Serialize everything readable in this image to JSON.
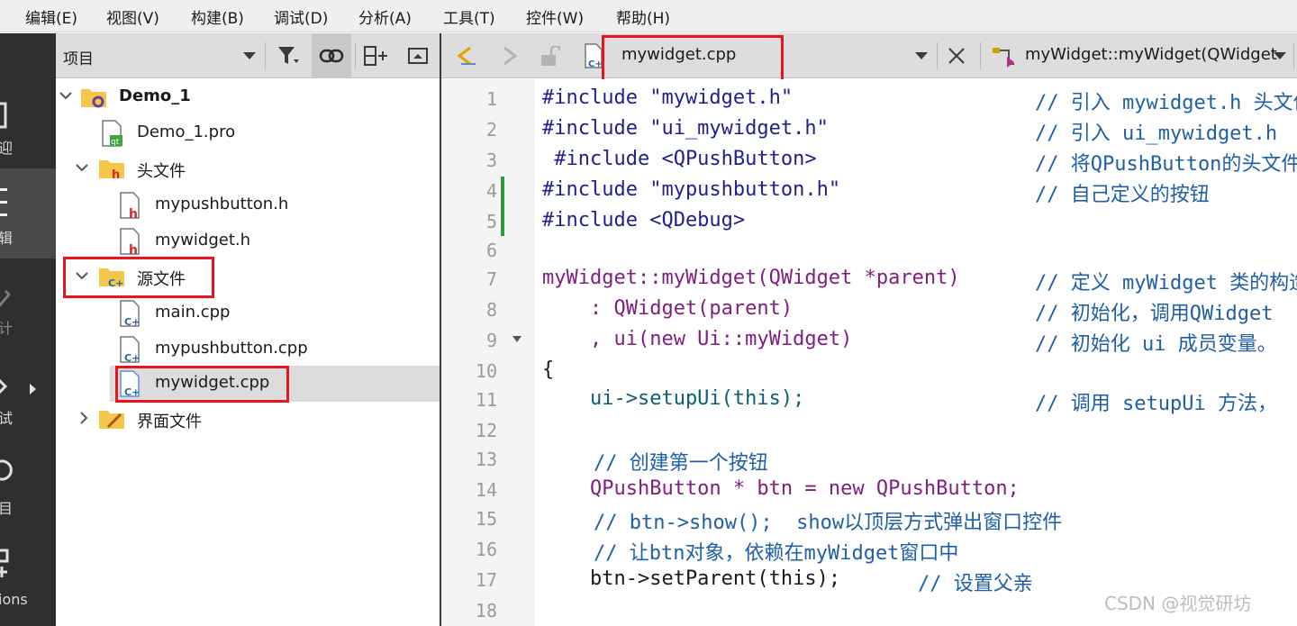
{
  "menu": [
    "编辑(E)",
    "视图(V)",
    "构建(B)",
    "调试(D)",
    "分析(A)",
    "工具(T)",
    "控件(W)",
    "帮助(H)"
  ],
  "modes": [
    {
      "label": "迎",
      "icon": "welcome-icon"
    },
    {
      "label": "辑",
      "icon": "edit-icon"
    },
    {
      "label": "计",
      "icon": "design-icon"
    },
    {
      "label": "试",
      "icon": "debug-icon"
    },
    {
      "label": "目",
      "icon": "projects-icon"
    },
    {
      "label": "ions",
      "icon": "extensions-icon"
    }
  ],
  "project_panel": {
    "title": "项目",
    "tree": [
      {
        "label": "Demo_1",
        "type": "project",
        "expanded": true
      },
      {
        "label": "Demo_1.pro",
        "type": "pro-file"
      },
      {
        "label": "头文件",
        "type": "folder-headers",
        "expanded": true
      },
      {
        "label": "mypushbutton.h",
        "type": "header-file"
      },
      {
        "label": "mywidget.h",
        "type": "header-file"
      },
      {
        "label": "源文件",
        "type": "folder-sources",
        "expanded": true
      },
      {
        "label": "main.cpp",
        "type": "source-file"
      },
      {
        "label": "mypushbutton.cpp",
        "type": "source-file"
      },
      {
        "label": "mywidget.cpp",
        "type": "source-file",
        "selected": true
      },
      {
        "label": "界面文件",
        "type": "folder-forms",
        "expanded": false
      }
    ]
  },
  "editor": {
    "file_name": "mywidget.cpp",
    "function": "myWidget::myWidget(QWidget",
    "line_numbers": [
      "1",
      "2",
      "3",
      "4",
      "5",
      "6",
      "7",
      "8",
      "9",
      "10",
      "11",
      "12",
      "13",
      "14",
      "15",
      "16",
      "17",
      "18"
    ],
    "lines": [
      {
        "code": "#include \"mywidget.h\"",
        "comment": "// 引入 mywidget.h 头文件"
      },
      {
        "code": "#include \"ui_mywidget.h\"",
        "comment": "// 引入 ui_mywidget.h"
      },
      {
        "code": " #include <QPushButton>",
        "comment": "// 将QPushButton的头文件"
      },
      {
        "code": "#include \"mypushbutton.h\"",
        "comment": "// 自己定义的按钮"
      },
      {
        "code": "#include <QDebug>",
        "comment": ""
      },
      {
        "code": "",
        "comment": ""
      },
      {
        "code": "myWidget::myWidget(QWidget *parent)",
        "comment": "// 定义 myWidget 类的构造函数"
      },
      {
        "code": "    : QWidget(parent)",
        "comment": "// 初始化，调用QWidget"
      },
      {
        "code": "    , ui(new Ui::myWidget)",
        "comment": "// 初始化 ui 成员变量。"
      },
      {
        "code": "{",
        "comment": ""
      },
      {
        "code": "    ui->setupUi(this);",
        "comment": "// 调用 setupUi 方法，"
      },
      {
        "code": "",
        "comment": ""
      },
      {
        "code": "",
        "comment": "// 创建第一个按钮"
      },
      {
        "code": "    QPushButton * btn = new QPushButton;",
        "comment": ""
      },
      {
        "code": "",
        "comment": "// btn->show();  show以顶层方式弹出窗口控件"
      },
      {
        "code": "",
        "comment": "// 让btn对象，依赖在myWidget窗口中"
      },
      {
        "code": "    btn->setParent(this);",
        "comment": "// 设置父亲"
      },
      {
        "code": "",
        "comment": ""
      }
    ]
  },
  "watermark": "CSDN @视觉研坊",
  "colors": {
    "highlight_box": "#e8161c",
    "comment": "#1f5fa6",
    "string": "#0a5f0a",
    "type": "#801f80"
  }
}
